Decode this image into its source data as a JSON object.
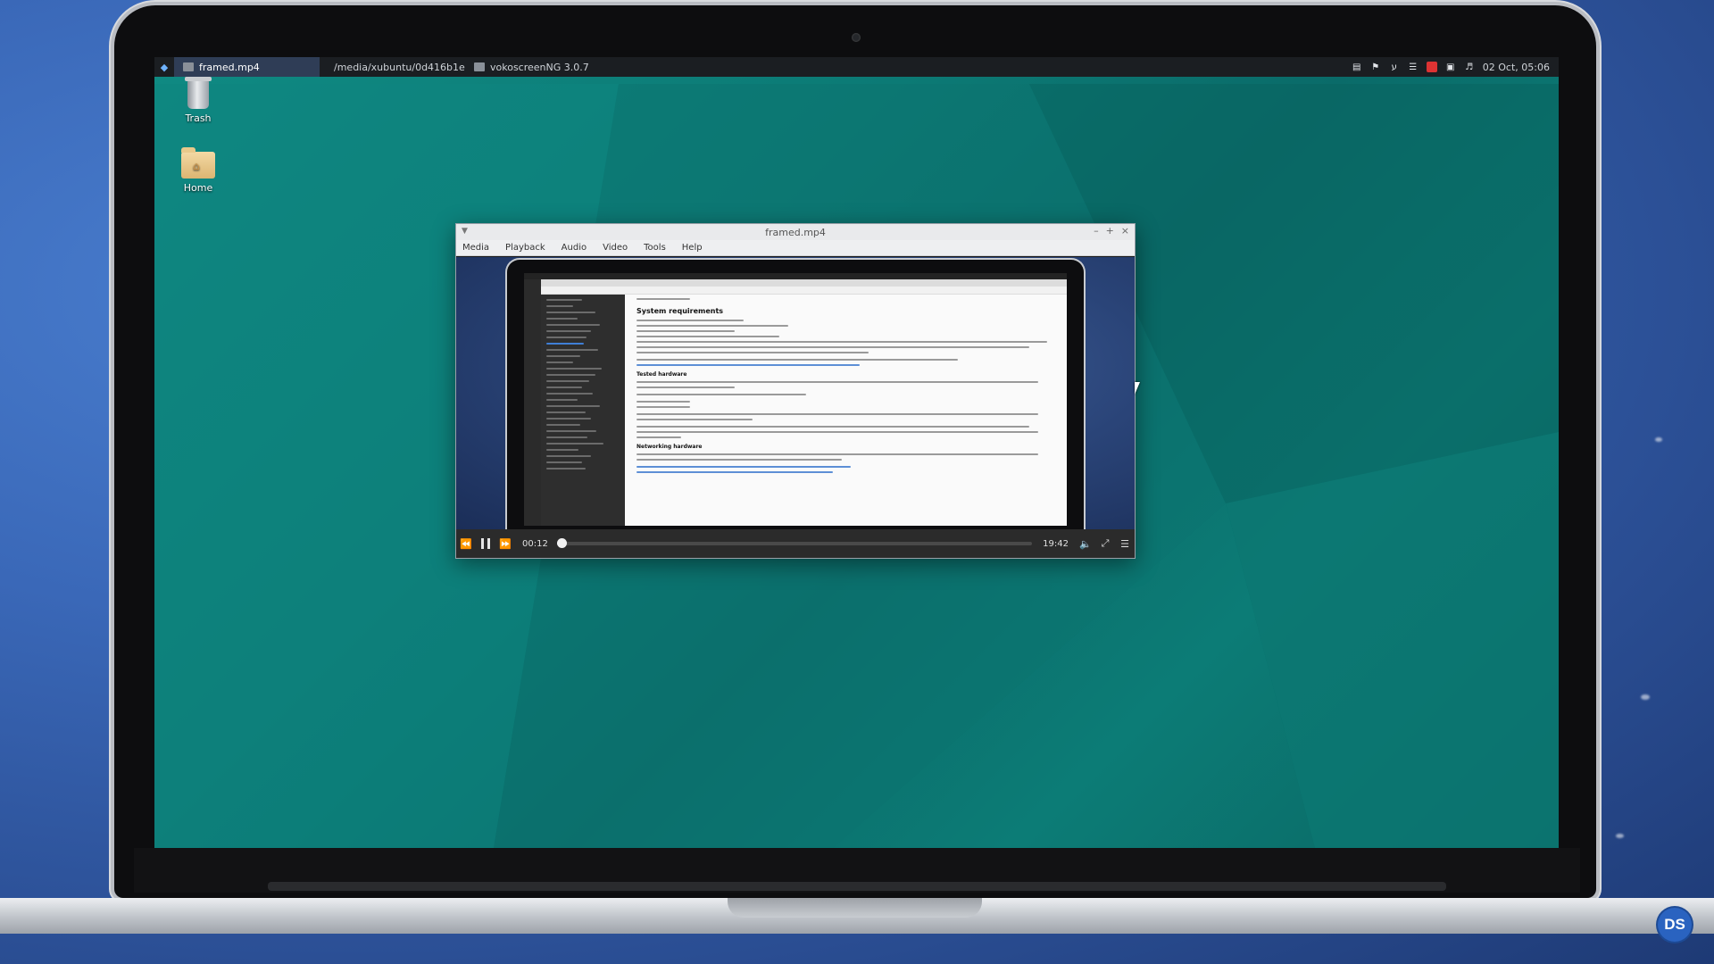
{
  "taskbar": {
    "tasks": [
      {
        "label": "framed.mp4",
        "active": true
      },
      {
        "label": "/media/xubuntu/0d416b1e-...",
        "active": false
      },
      {
        "label": "vokoscreenNG 3.0.7",
        "active": false
      }
    ],
    "clock": "02 Oct, 05:06",
    "tray_icons": [
      "clipboard-icon",
      "bell-icon",
      "bluetooth-icon",
      "wifi-icon",
      "record-icon",
      "lock-icon",
      "volume-icon"
    ]
  },
  "desktop": {
    "icons": [
      {
        "label": "Trash",
        "icon": "trash-icon"
      },
      {
        "label": "Home",
        "icon": "home-folder-icon"
      }
    ]
  },
  "vlc": {
    "title": "framed.mp4",
    "menu": [
      "Media",
      "Playback",
      "Audio",
      "Video",
      "Tools",
      "Help"
    ],
    "time_elapsed": "00:12",
    "time_total": "19:42",
    "progress_fraction": 0.01,
    "video_content": {
      "heading_1": "System requirements",
      "heading_2": "Tested hardware",
      "heading_3": "Networking hardware"
    }
  },
  "badge": "DS",
  "colors": {
    "desktop_teal": "#0c7a75",
    "taskbar": "#1b1e22",
    "active_task": "#2f3d56",
    "accent": "#2a63c0"
  }
}
